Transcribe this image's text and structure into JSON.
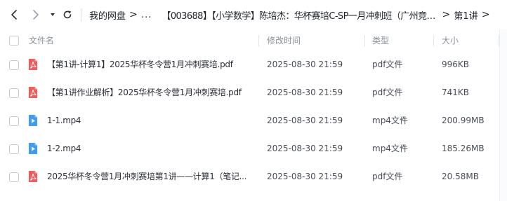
{
  "toolbar": {
    "back_icon": "chevron-left-icon",
    "forward_icon": "chevron-right-icon",
    "dropdown_icon": "caret-down-icon",
    "refresh_icon": "refresh-icon"
  },
  "breadcrumb": {
    "items": [
      {
        "label": "我的网盘"
      },
      {
        "label": "..."
      },
      {
        "label": "【003688】【小学数学】陈培杰：华杯赛培C-SP一月冲刺班（广州竞赛..."
      },
      {
        "label": "第1讲"
      }
    ],
    "separator": ">"
  },
  "table": {
    "headers": {
      "name": "文件名",
      "modified": "修改时间",
      "type": "类型",
      "size": "大小"
    },
    "rows": [
      {
        "name": "【第1讲-计算1】2025华杯冬令营1月冲刺赛培.pdf",
        "modified": "2025-08-30 21:59",
        "type": "pdf文件",
        "size": "996KB",
        "icon": "pdf-file-icon"
      },
      {
        "name": "【第1讲作业解析】2025华杯冬令营1月冲刺赛培.pdf",
        "modified": "2025-08-30 21:59",
        "type": "pdf文件",
        "size": "741KB",
        "icon": "pdf-file-icon"
      },
      {
        "name": "1-1.mp4",
        "modified": "2025-08-30 21:59",
        "type": "mp4文件",
        "size": "200.99MB",
        "icon": "video-file-icon"
      },
      {
        "name": "1-2.mp4",
        "modified": "2025-08-30 21:59",
        "type": "mp4文件",
        "size": "185.26MB",
        "icon": "video-file-icon"
      },
      {
        "name": "2025华杯冬令营1月冲刺赛培第1讲——计算1（笔记...",
        "modified": "2025-08-30 21:59",
        "type": "pdf文件",
        "size": "20.58MB",
        "icon": "pdf-file-icon"
      }
    ]
  },
  "colors": {
    "pdf_icon": "#f25a5a",
    "video_icon": "#3d9cf5",
    "header_text": "#8a9099",
    "body_text": "#2b2f36"
  }
}
